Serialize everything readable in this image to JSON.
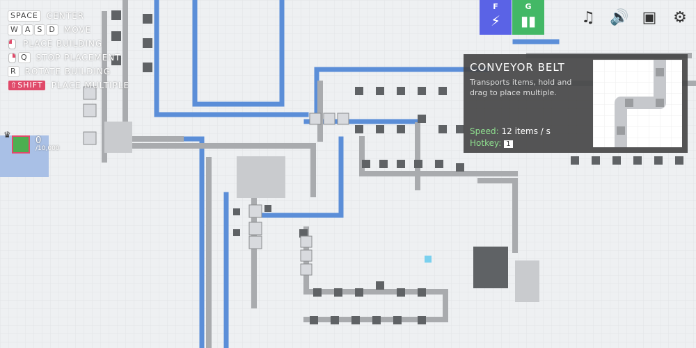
{
  "hotkeys": [
    {
      "keys": [
        "SPACE"
      ],
      "label": "CENTER"
    },
    {
      "keys": [
        "W",
        "A",
        "S",
        "D"
      ],
      "label": "MOVE"
    },
    {
      "keys": [
        "mouse-left"
      ],
      "label": "PLACE BUILDING"
    },
    {
      "keys": [
        "mouse-right",
        "Q"
      ],
      "label": "STOP PLACEMENT"
    },
    {
      "keys": [
        "R"
      ],
      "label": "ROTATE BUILDING"
    },
    {
      "keys": [
        "⇧SHIFT"
      ],
      "label": "PLACE MULTIPLE"
    }
  ],
  "hub": {
    "count": "0",
    "goal": "/10,000",
    "crown": "♛"
  },
  "toolbar": [
    {
      "key": "F",
      "icon": "wand-icon",
      "color": "#5a63e6"
    },
    {
      "key": "G",
      "icon": "bar-chart-icon",
      "color": "#43b866"
    }
  ],
  "top_icons": [
    "music-icon",
    "sound-icon",
    "save-icon",
    "settings-icon"
  ],
  "tooltip": {
    "title": "CONVEYOR BELT",
    "description": "Transports items, hold and drag to place multiple.",
    "speed_label": "Speed:",
    "speed_value": "12 items / s",
    "hotkey_label": "Hotkey:",
    "hotkey_value": "1"
  },
  "colors": {
    "belt_blue": "#5b8ed8",
    "belt_gray": "#a9abae",
    "building": "#5f6265",
    "background": "#eef0f2"
  }
}
